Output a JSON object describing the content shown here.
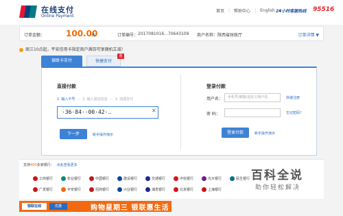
{
  "header": {
    "logo_cn": "在线支付",
    "logo_en": "Online Payment",
    "links": [
      "首页",
      "帮助中心",
      "English"
    ],
    "hotline_label": "24小时客服热线",
    "hotline_number": "95516"
  },
  "order": {
    "amount_label": "订单金额：",
    "amount": "100.00",
    "amount_unit": "元",
    "order_no_label": "订单编号：",
    "order_no": "2017081016...70643109",
    "merchant_label": "商户名称：",
    "merchant": "陕西省财政厅",
    "detail_link": "订单详情 ▼"
  },
  "notice": "周三10点起，平安信用卡指定商户满百可享随机立减！",
  "tabs": [
    {
      "label": "银联卡支付",
      "active": true
    },
    {
      "label": "快捷支付",
      "badge": "惠"
    }
  ],
  "direct_pay": {
    "title": "直接付款",
    "steps": [
      "1. 输入卡号",
      "2. 输入验证信息",
      "3. 完成支付"
    ],
    "card_number": "·36·84··00·42·‥",
    "clear_icon": "close-icon",
    "next_button": "下一步",
    "guide_link": "新手操作演示"
  },
  "login_pay": {
    "title": "登录付款",
    "username_label": "用户名：",
    "username_placeholder": "手机号/邮箱/自定义用户名",
    "register_link": "快速注册",
    "password_label": "密  码：",
    "forgot_link": "忘记密码？",
    "login_button": "登录付款",
    "guide_link": "新手操作演示"
  },
  "banks": {
    "head_prefix": "支持",
    "head_count": "400",
    "head_suffix": "多家银行：",
    "more_link": "点此查看更多",
    "row1": [
      {
        "name": "工商银行",
        "color": "#c8161d"
      },
      {
        "name": "农业银行",
        "color": "#0f8b6c"
      },
      {
        "name": "中国银行",
        "color": "#b81c22"
      },
      {
        "name": "建设银行",
        "color": "#0a4a9c"
      },
      {
        "name": "交通银行",
        "color": "#1d2a8a"
      },
      {
        "name": "中信银行",
        "color": "#d4151c"
      },
      {
        "name": "光大银行",
        "color": "#6a1f8a"
      },
      {
        "name": "民生银行",
        "color": "#0b6e8a"
      }
    ],
    "row2": [
      {
        "name": "广发银行",
        "color": "#c8161d"
      },
      {
        "name": "平安银行",
        "color": "#f26a10"
      },
      {
        "name": "招商银行",
        "color": "#c8161d"
      },
      {
        "name": "兴业银行",
        "color": "#0a4a9c"
      },
      {
        "name": "浦发银行",
        "color": "#1d2a8a"
      },
      {
        "name": "北京银行",
        "color": "#d4151c"
      },
      {
        "name": "上海银行",
        "color": "#c8161d"
      }
    ]
  },
  "promo": {
    "logo1": "银联在线",
    "logo2": "优惠",
    "text": "购物星期三 银联惠生活"
  },
  "watermark": {
    "title": "百科全说",
    "subtitle": "助你轻松解决"
  }
}
